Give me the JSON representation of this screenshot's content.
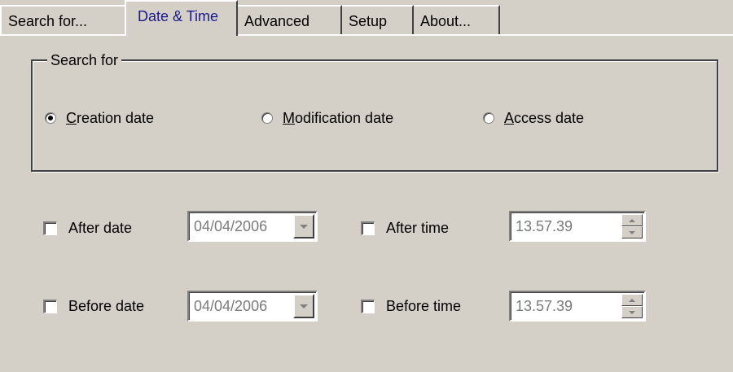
{
  "tabs": [
    {
      "label": "Search for...",
      "active": false
    },
    {
      "label": "Date & Time",
      "active": true
    },
    {
      "label": "Advanced",
      "active": false
    },
    {
      "label": "Setup",
      "active": false
    },
    {
      "label": "About...",
      "active": false
    }
  ],
  "search_for": {
    "legend": "Search for",
    "options": [
      {
        "accel": "C",
        "rest": "reation date",
        "checked": true
      },
      {
        "accel": "M",
        "rest": "odification date",
        "checked": false
      },
      {
        "accel": "A",
        "rest": "ccess date",
        "checked": false
      }
    ]
  },
  "filters": {
    "after_date": {
      "label": "After date",
      "checked": false,
      "value": "04/04/2006"
    },
    "before_date": {
      "label": "Before date",
      "checked": false,
      "value": "04/04/2006"
    },
    "after_time": {
      "label": "After time",
      "checked": false,
      "value": "13.57.39"
    },
    "before_time": {
      "label": "Before time",
      "checked": false,
      "value": "13.57.39"
    }
  },
  "colors": {
    "face": "#d4d0c8",
    "active_tab_text": "#1a1a8c",
    "disabled_text": "#7a7a7a"
  }
}
